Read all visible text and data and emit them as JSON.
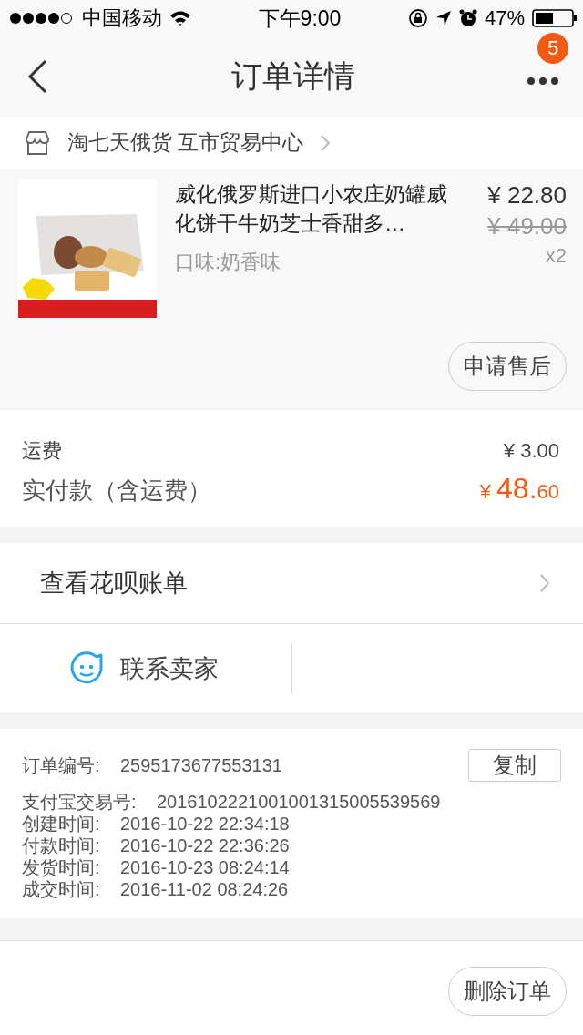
{
  "status_bar": {
    "carrier": "中国移动",
    "time": "下午9:00",
    "battery": "47%"
  },
  "nav": {
    "title": "订单详情",
    "badge": "5"
  },
  "store": {
    "name": "淘七天俄货 互市贸易中心"
  },
  "item": {
    "kind": "picture",
    "title": "威化俄罗斯进口小农庄奶罐威化饼干牛奶芝士香甜多…",
    "variant": "口味:奶香味",
    "price": "¥ 22.80",
    "original_price": "¥ 49.00",
    "quantity": "x2",
    "action": "申请售后"
  },
  "fees": {
    "shipping_label": "运费",
    "shipping": "¥ 3.00",
    "total_label": "实付款（含运费）",
    "total_symbol": "¥",
    "total_integer": "48.",
    "total_decimal": "60"
  },
  "huabei": {
    "label": "查看花呗账单"
  },
  "contact": {
    "label": "联系卖家"
  },
  "order_info": {
    "copy_button": "复制",
    "rows": [
      {
        "label": "订单编号:",
        "value": "2595173677553131"
      },
      {
        "label": "支付宝交易号:",
        "value": "2016102221001001315005539569"
      },
      {
        "label": "创建时间:",
        "value": "2016-10-22 22:34:18"
      },
      {
        "label": "付款时间:",
        "value": "2016-10-22 22:36:26"
      },
      {
        "label": "发货时间:",
        "value": "2016-10-23 08:24:14"
      },
      {
        "label": "成交时间:",
        "value": "2016-11-02 08:24:26"
      }
    ]
  },
  "bottom": {
    "button": "删除订单"
  }
}
